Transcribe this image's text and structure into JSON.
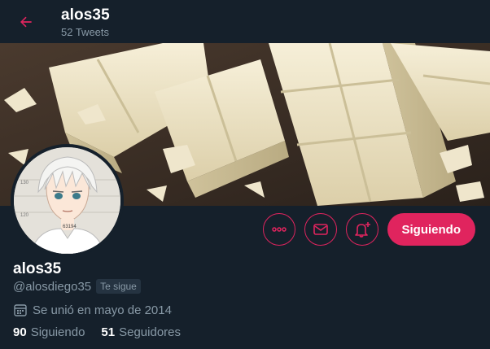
{
  "header": {
    "back_icon": "arrow-left-icon",
    "name": "alos35",
    "tweets_count": "52 Tweets"
  },
  "banner": {
    "image": "white-chocolate-bars-photo"
  },
  "avatar": {
    "image": "anime-character-avatar"
  },
  "actions": {
    "more_icon": "more-dots-icon",
    "message_icon": "envelope-icon",
    "notify_icon": "bell-plus-icon",
    "follow_label": "Siguiendo"
  },
  "profile": {
    "name": "alos35",
    "handle": "@alosdiego35",
    "follows_you": "Te sigue",
    "joined_icon": "calendar-icon",
    "joined": "Se unió en mayo de 2014",
    "following_count": "90",
    "following_label": "Siguiendo",
    "followers_count": "51",
    "followers_label": "Seguidores"
  },
  "colors": {
    "background": "#15202b",
    "accent": "#e0245e",
    "secondary_text": "#8899a6"
  }
}
